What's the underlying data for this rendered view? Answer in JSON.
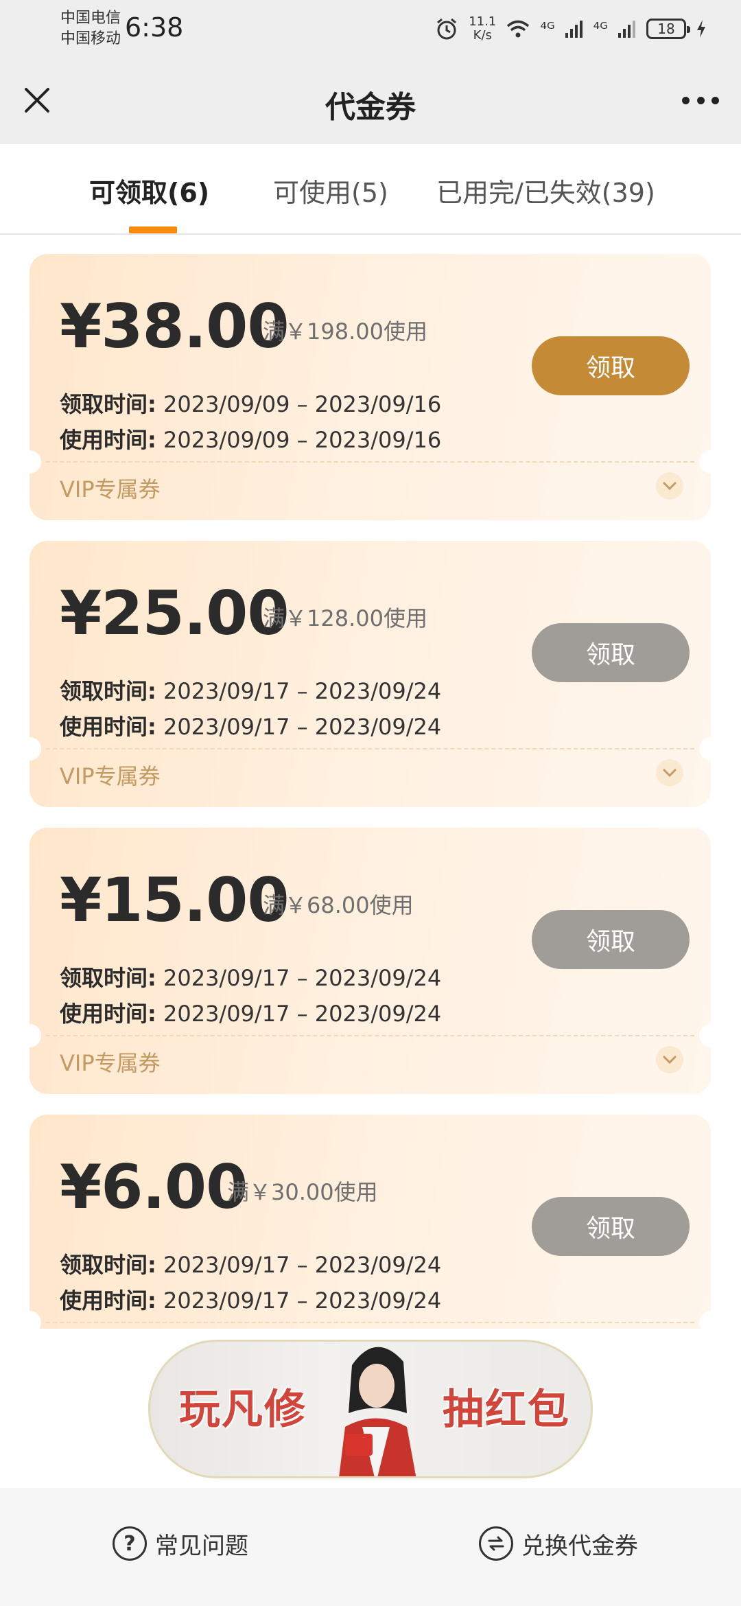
{
  "status_bar": {
    "carrier1": "中国电信",
    "carrier2": "中国移动",
    "time": "6:38",
    "net_speed_value": "11.1",
    "net_speed_unit": "K/s",
    "signal1": "⁴ᴳ",
    "signal2": "⁴ᴳ",
    "battery": "18"
  },
  "nav": {
    "title": "代金券"
  },
  "tabs": [
    {
      "label": "可领取(6)"
    },
    {
      "label": "可使用(5)"
    },
    {
      "label": "已用完/已失效(39)"
    }
  ],
  "coupons": [
    {
      "amount": "¥38.00",
      "condition": "满￥198.00使用",
      "claim_label": "领取时间:",
      "claim_range": "2023/09/09 – 2023/09/16",
      "use_label": "使用时间:",
      "use_range": "2023/09/09 – 2023/09/16",
      "button": "领取",
      "tag": "VIP专属券",
      "button_state": "active"
    },
    {
      "amount": "¥25.00",
      "condition": "满￥128.00使用",
      "claim_label": "领取时间:",
      "claim_range": "2023/09/17 – 2023/09/24",
      "use_label": "使用时间:",
      "use_range": "2023/09/17 – 2023/09/24",
      "button": "领取",
      "tag": "VIP专属券",
      "button_state": "disabled"
    },
    {
      "amount": "¥15.00",
      "condition": "满￥68.00使用",
      "claim_label": "领取时间:",
      "claim_range": "2023/09/17 – 2023/09/24",
      "use_label": "使用时间:",
      "use_range": "2023/09/17 – 2023/09/24",
      "button": "领取",
      "tag": "VIP专属券",
      "button_state": "disabled"
    },
    {
      "amount": "¥6.00",
      "condition": "满￥30.00使用",
      "claim_label": "领取时间:",
      "claim_range": "2023/09/17 – 2023/09/24",
      "use_label": "使用时间:",
      "use_range": "2023/09/17 – 2023/09/24",
      "button": "领取",
      "tag": "",
      "button_state": "disabled"
    }
  ],
  "banner": {
    "left_text": "玩凡修",
    "right_text": "抽红包"
  },
  "footer": {
    "faq_label": "常见问题",
    "exchange_label": "兑换代金券"
  },
  "colors": {
    "accent": "#f68b0f",
    "button_active": "#c48a35",
    "button_disabled": "#a09d99",
    "tag_text": "#c39a62"
  }
}
